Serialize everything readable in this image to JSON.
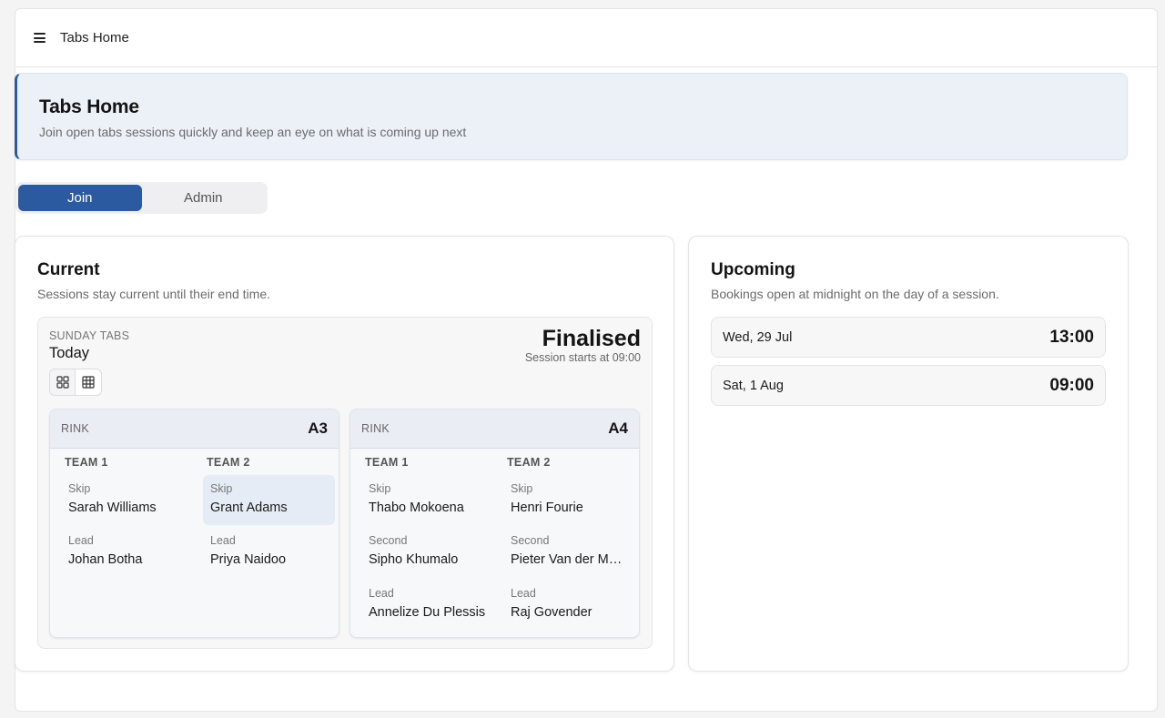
{
  "topbar": {
    "title": "Tabs Home",
    "menu_icon": "hamburger-menu-icon"
  },
  "hero": {
    "title": "Tabs Home",
    "subtitle": "Join open tabs sessions quickly and keep an eye on what is coming up next"
  },
  "toggle": {
    "options": [
      "Join",
      "Admin"
    ],
    "selected": "Join"
  },
  "current": {
    "title": "Current",
    "subtitle": "Sessions stay current until their end time.",
    "session": {
      "label": "SUNDAY TABS",
      "day": "Today",
      "status": "Finalised",
      "starts": "Session starts at 09:00",
      "view_icons": [
        "grid-view-icon",
        "table-view-icon"
      ],
      "rinks": [
        {
          "label": "RINK",
          "code": "A3",
          "teams": [
            {
              "name": "TEAM 1",
              "players": [
                {
                  "position": "Skip",
                  "name": "Sarah Williams"
                },
                {
                  "position": "Lead",
                  "name": "Johan Botha"
                }
              ]
            },
            {
              "name": "TEAM 2",
              "players": [
                {
                  "position": "Skip",
                  "name": "Grant Adams",
                  "highlighted": true
                },
                {
                  "position": "Lead",
                  "name": "Priya Naidoo"
                }
              ]
            }
          ]
        },
        {
          "label": "RINK",
          "code": "A4",
          "teams": [
            {
              "name": "TEAM 1",
              "players": [
                {
                  "position": "Skip",
                  "name": "Thabo Mokoena"
                },
                {
                  "position": "Second",
                  "name": "Sipho Khumalo"
                },
                {
                  "position": "Lead",
                  "name": "Annelize Du Plessis"
                }
              ]
            },
            {
              "name": "TEAM 2",
              "players": [
                {
                  "position": "Skip",
                  "name": "Henri Fourie"
                },
                {
                  "position": "Second",
                  "name": "Pieter Van der Mer..."
                },
                {
                  "position": "Lead",
                  "name": "Raj Govender"
                }
              ]
            }
          ]
        }
      ]
    }
  },
  "upcoming": {
    "title": "Upcoming",
    "subtitle": "Bookings open at midnight on the day of a session.",
    "items": [
      {
        "date": "Wed, 29 Jul",
        "time": "13:00"
      },
      {
        "date": "Sat, 1 Aug",
        "time": "09:00"
      }
    ]
  },
  "colors": {
    "accent": "#2c5aa0",
    "highlight": "#e6ecf5"
  }
}
